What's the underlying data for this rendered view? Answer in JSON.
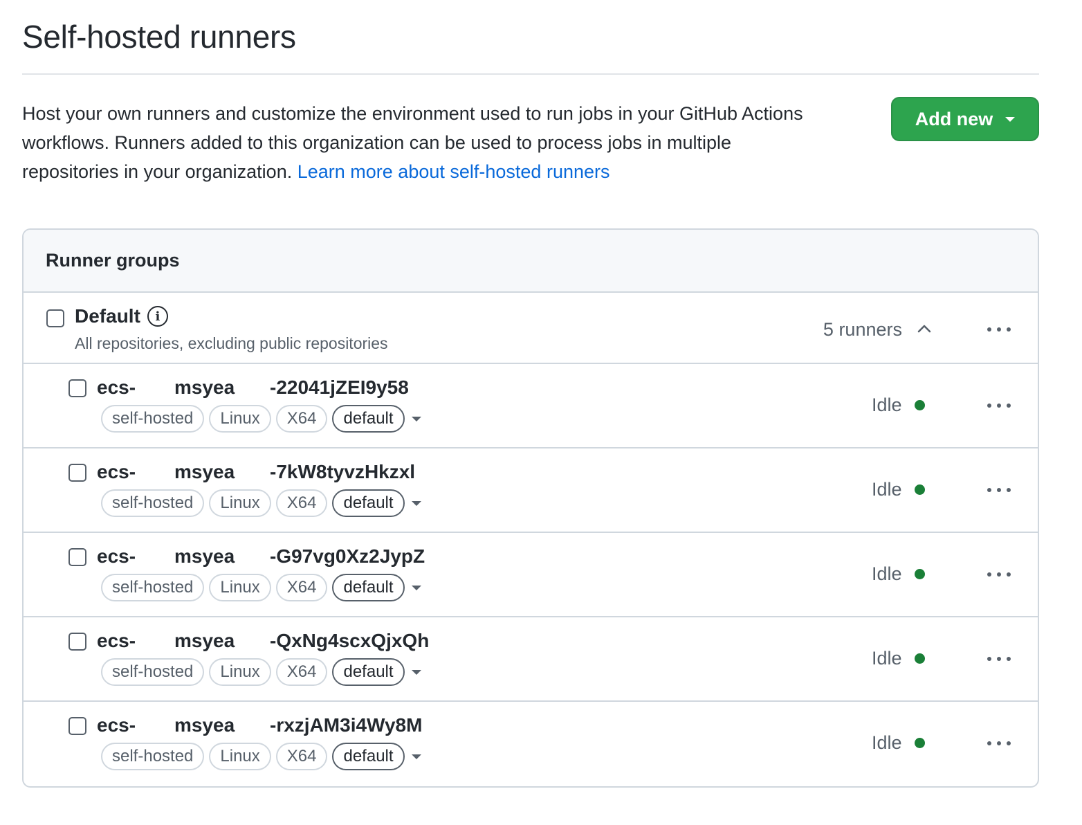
{
  "page": {
    "title": "Self-hosted runners",
    "description": "Host your own runners and customize the environment used to run jobs in your GitHub Actions workflows. Runners added to this organization can be used to process jobs in multiple repositories in your organization.",
    "learn_more_link": "Learn more about self-hosted runners",
    "add_new_label": "Add new"
  },
  "panel": {
    "header": "Runner groups",
    "group": {
      "name": "Default",
      "description": "All repositories, excluding public repositories",
      "runner_count": "5 runners"
    }
  },
  "runners": [
    {
      "name_part1": "ecs-",
      "name_part2": "msyea",
      "name_part3": "-22041jZEI9y58",
      "labels": [
        "self-hosted",
        "Linux",
        "X64",
        "default"
      ],
      "status": "Idle"
    },
    {
      "name_part1": "ecs-",
      "name_part2": "msyea",
      "name_part3": "-7kW8tyvzHkzxl",
      "labels": [
        "self-hosted",
        "Linux",
        "X64",
        "default"
      ],
      "status": "Idle"
    },
    {
      "name_part1": "ecs-",
      "name_part2": "msyea",
      "name_part3": "-G97vg0Xz2JypZ",
      "labels": [
        "self-hosted",
        "Linux",
        "X64",
        "default"
      ],
      "status": "Idle"
    },
    {
      "name_part1": "ecs-",
      "name_part2": "msyea",
      "name_part3": "-QxNg4scxQjxQh",
      "labels": [
        "self-hosted",
        "Linux",
        "X64",
        "default"
      ],
      "status": "Idle"
    },
    {
      "name_part1": "ecs-",
      "name_part2": "msyea",
      "name_part3": "-rxzjAM3i4Wy8M",
      "labels": [
        "self-hosted",
        "Linux",
        "X64",
        "default"
      ],
      "status": "Idle"
    }
  ],
  "icons": {
    "info": "info-icon",
    "chevron": "chevron-up-icon",
    "more": "kebab-horizontal-icon",
    "caret": "caret-down-icon"
  },
  "colors": {
    "primary_button": "#2da44e",
    "link": "#0969da",
    "status_idle": "#1a7f37"
  }
}
